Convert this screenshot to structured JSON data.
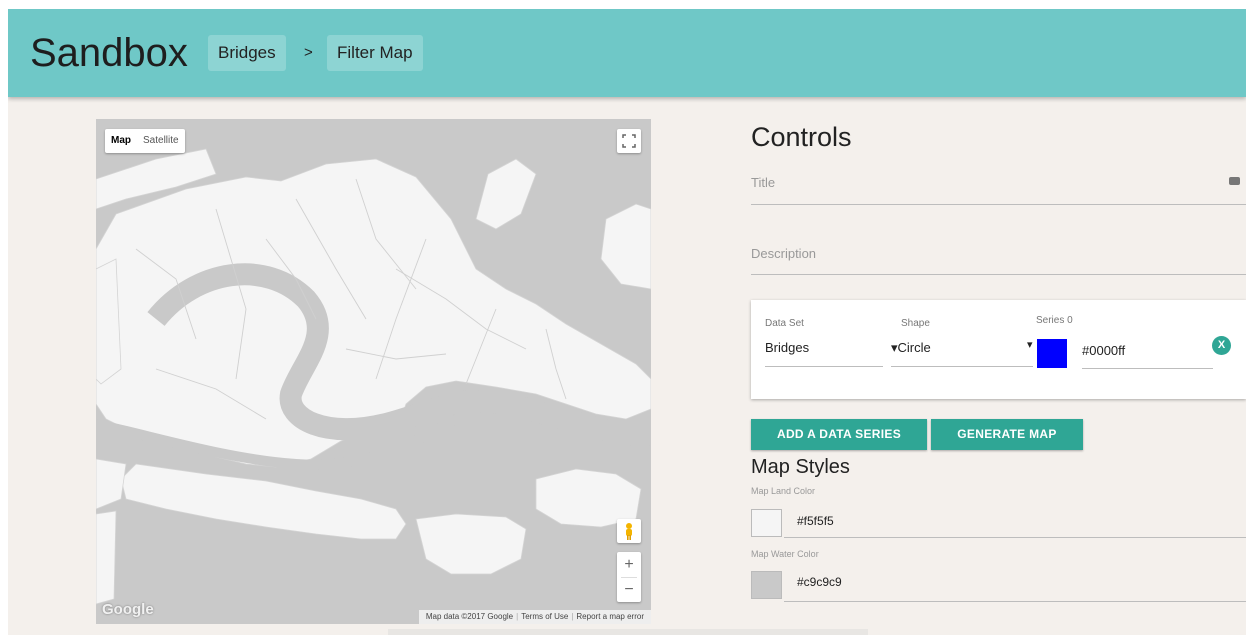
{
  "header": {
    "title": "Sandbox",
    "breadcrumbs": [
      "Bridges",
      "Filter Map"
    ],
    "separator": ">",
    "background": "#6fc8c7"
  },
  "map": {
    "type_toggle": [
      "Map",
      "Satellite"
    ],
    "active_type": "Map",
    "logo": "Google",
    "attribution": [
      "Map data ©2017 Google",
      "Terms of Use",
      "Report a map error"
    ],
    "zoom_in": "+",
    "zoom_out": "−",
    "land_color": "#f5f5f5",
    "water_color": "#c9c9c9",
    "icons": [
      "fullscreen-icon",
      "pegman-icon"
    ]
  },
  "controls": {
    "title": "Controls",
    "title_field": {
      "label": "Title",
      "value": ""
    },
    "description_field": {
      "label": "Description",
      "value": ""
    },
    "series": {
      "data_set_label": "Data Set",
      "data_set_value": "Bridges",
      "shape_label": "Shape",
      "shape_value": "Circle",
      "dropdown_arrow": "▾",
      "series_label": "Series 0",
      "series_color": "#0000ff",
      "remove_label": "X"
    },
    "buttons": {
      "add_series": "ADD A DATA SERIES",
      "generate_map": "GENERATE MAP"
    },
    "accent": "#2fa695"
  },
  "map_styles": {
    "title": "Map Styles",
    "land": {
      "label": "Map Land Color",
      "value": "#f5f5f5"
    },
    "water": {
      "label": "Map Water Color",
      "value": "#c9c9c9"
    }
  }
}
